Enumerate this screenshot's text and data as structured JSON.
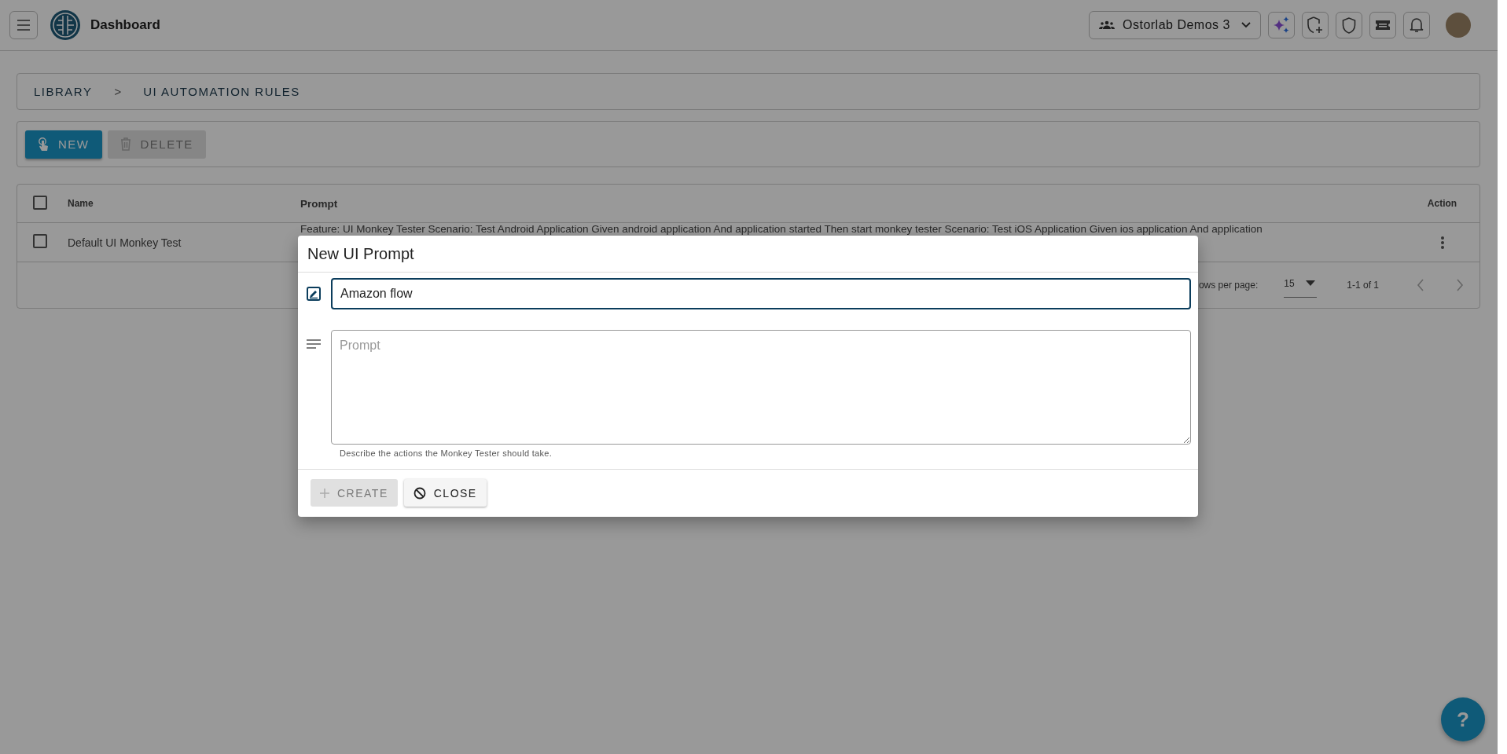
{
  "topbar": {
    "title": "Dashboard",
    "org_selector": "Ostorlab Demos 3"
  },
  "breadcrumb": [
    "LIBRARY",
    ">",
    "UI AUTOMATION RULES"
  ],
  "toolbar": [
    {
      "kind": "new",
      "label": "NEW",
      "disabled": false
    },
    {
      "kind": "delete",
      "label": "DELETE",
      "disabled": true
    }
  ],
  "table": {
    "columns": [
      "Name",
      "Prompt",
      "Action"
    ],
    "header_checked": false,
    "rows": [
      {
        "checked": false,
        "name": "Default UI Monkey Test",
        "prompt": "Feature: UI Monkey Tester Scenario: Test Android Application Given android application And application started Then start monkey tester Scenario: Test iOS Application Given ios application And application"
      }
    ],
    "footer": {
      "rows_per_page_label": "ows per page:",
      "rows_per_page": "15",
      "range": "1-1 of 1"
    }
  },
  "dialog": {
    "title": "New UI Prompt",
    "name_value": "Amazon flow",
    "prompt_placeholder": "Prompt",
    "helper": "Describe the actions the Monkey Tester should take.",
    "buttons": [
      {
        "kind": "create",
        "label": "CREATE",
        "disabled": true
      },
      {
        "kind": "close",
        "label": "CLOSE",
        "disabled": false
      }
    ]
  },
  "help_button": "?"
}
